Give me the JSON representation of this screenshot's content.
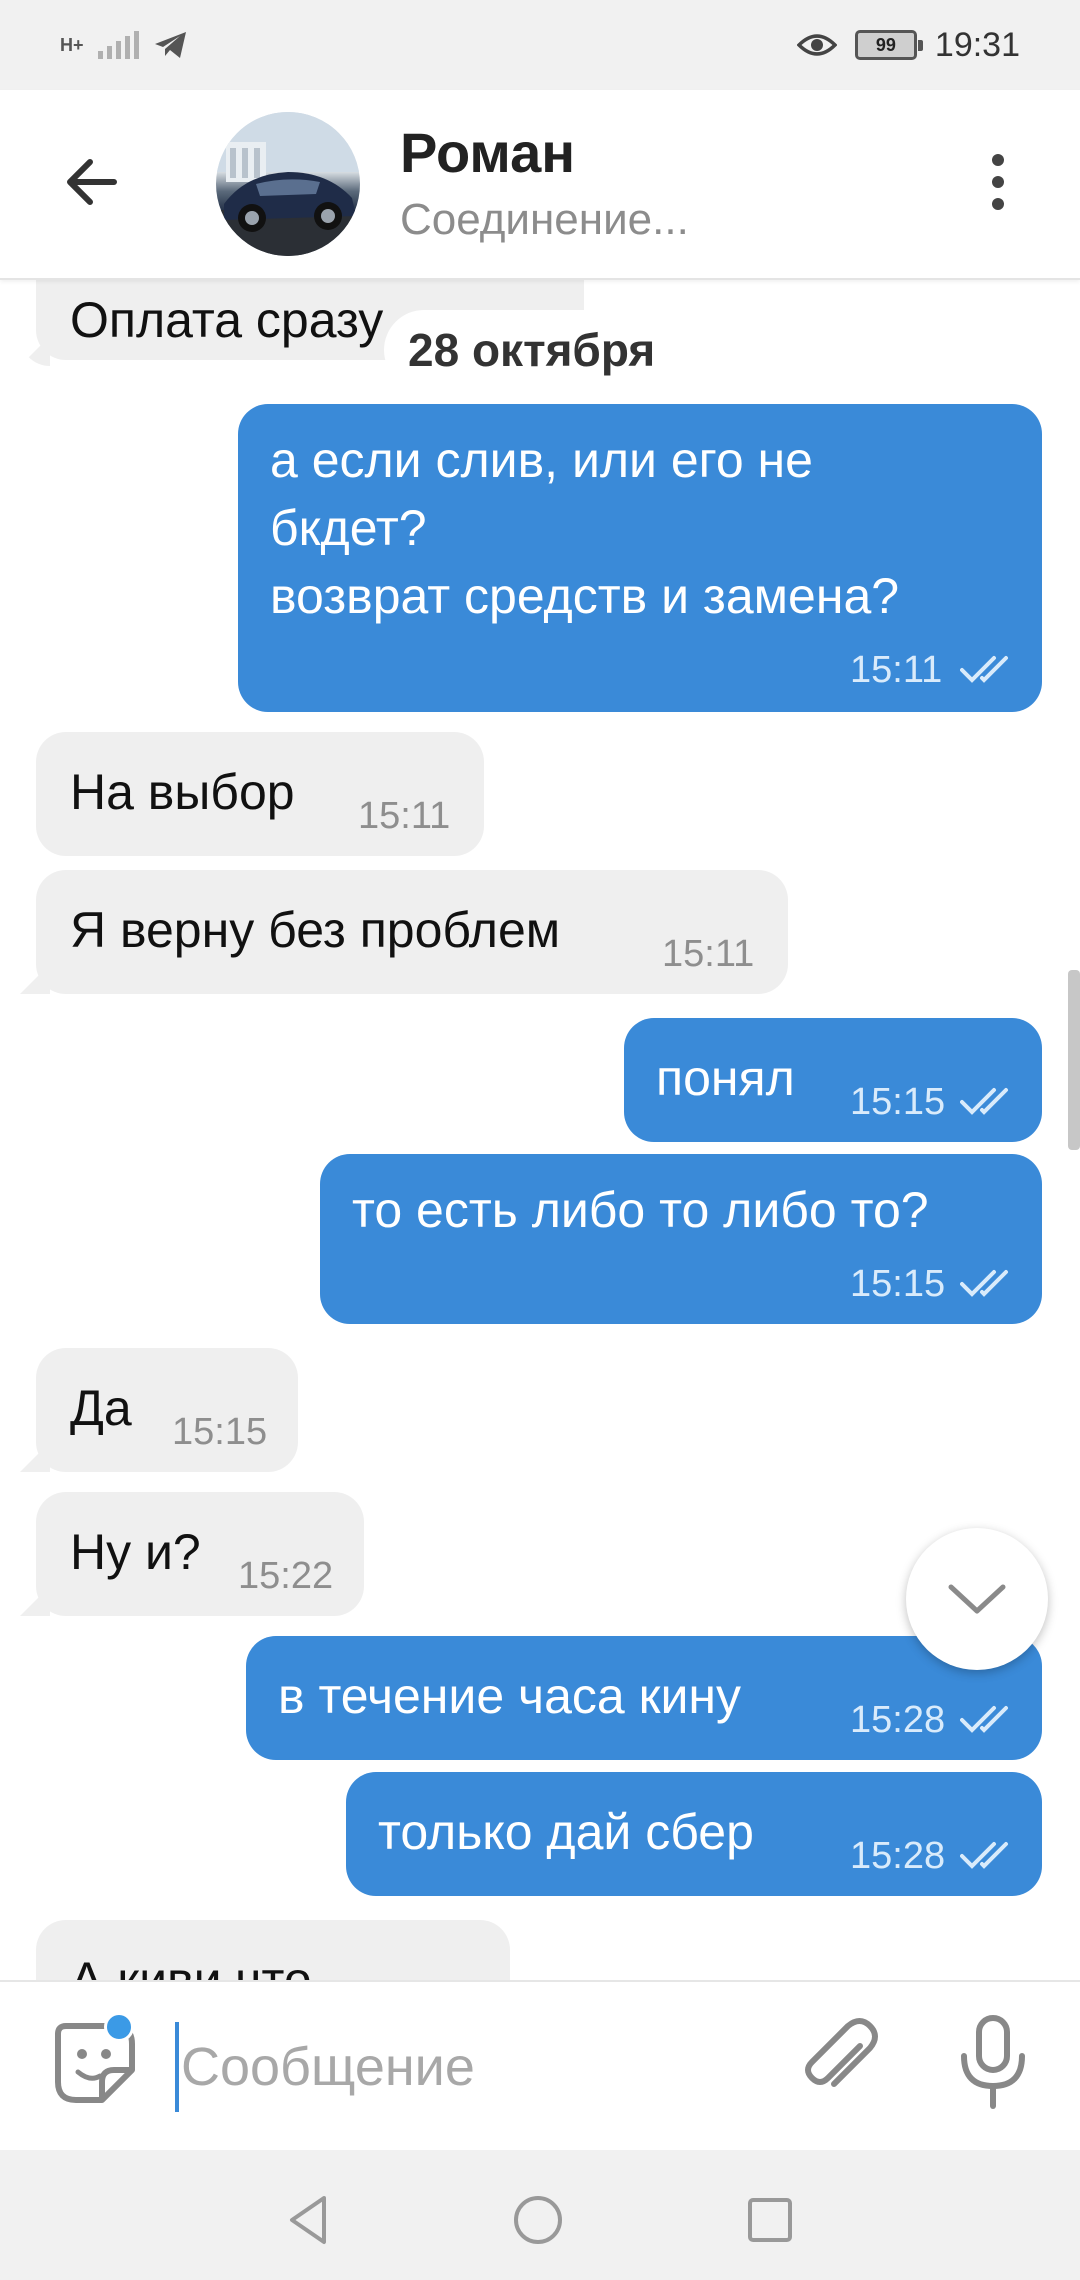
{
  "status_bar": {
    "network_label": "H+",
    "battery_level": "99",
    "time": "19:31"
  },
  "header": {
    "contact_name": "Роман",
    "contact_status": "Соединение..."
  },
  "chat": {
    "partial_top_message": "Оплата сразу",
    "date_separator": "28 октября",
    "messages": [
      {
        "direction": "out",
        "text": "а если слив, или его не\nбкдет?\nвозврат средств и замена?",
        "time": "15:11",
        "status": "read"
      },
      {
        "direction": "in",
        "text": "На выбор",
        "time": "15:11"
      },
      {
        "direction": "in",
        "text": "Я верну без проблем",
        "time": "15:11"
      },
      {
        "direction": "out",
        "text": "понял",
        "time": "15:15",
        "status": "read"
      },
      {
        "direction": "out",
        "text": "то есть либо то либо то?",
        "time": "15:15",
        "status": "read"
      },
      {
        "direction": "in",
        "text": "Да",
        "time": "15:15"
      },
      {
        "direction": "in",
        "text": "Ну и?",
        "time": "15:22"
      },
      {
        "direction": "out",
        "text": "в течение часа кину",
        "time": "15:28",
        "status": "read"
      },
      {
        "direction": "out",
        "text": "только дай сбер",
        "time": "15:28",
        "status": "read"
      },
      {
        "direction": "in",
        "text": "А киви что",
        "time": ""
      }
    ]
  },
  "composer": {
    "placeholder": "Сообщение",
    "value": ""
  },
  "colors": {
    "outgoing_bubble": "#3a8ad8",
    "incoming_bubble": "#efefef",
    "accent": "#3b9ae6"
  },
  "icons": {
    "back": "arrow-left-icon",
    "menu": "more-vertical-icon",
    "sticker": "sticker-icon",
    "attach": "paperclip-icon",
    "mic": "microphone-icon",
    "scroll_down": "chevron-down-icon",
    "read_ticks": "double-check-icon"
  }
}
